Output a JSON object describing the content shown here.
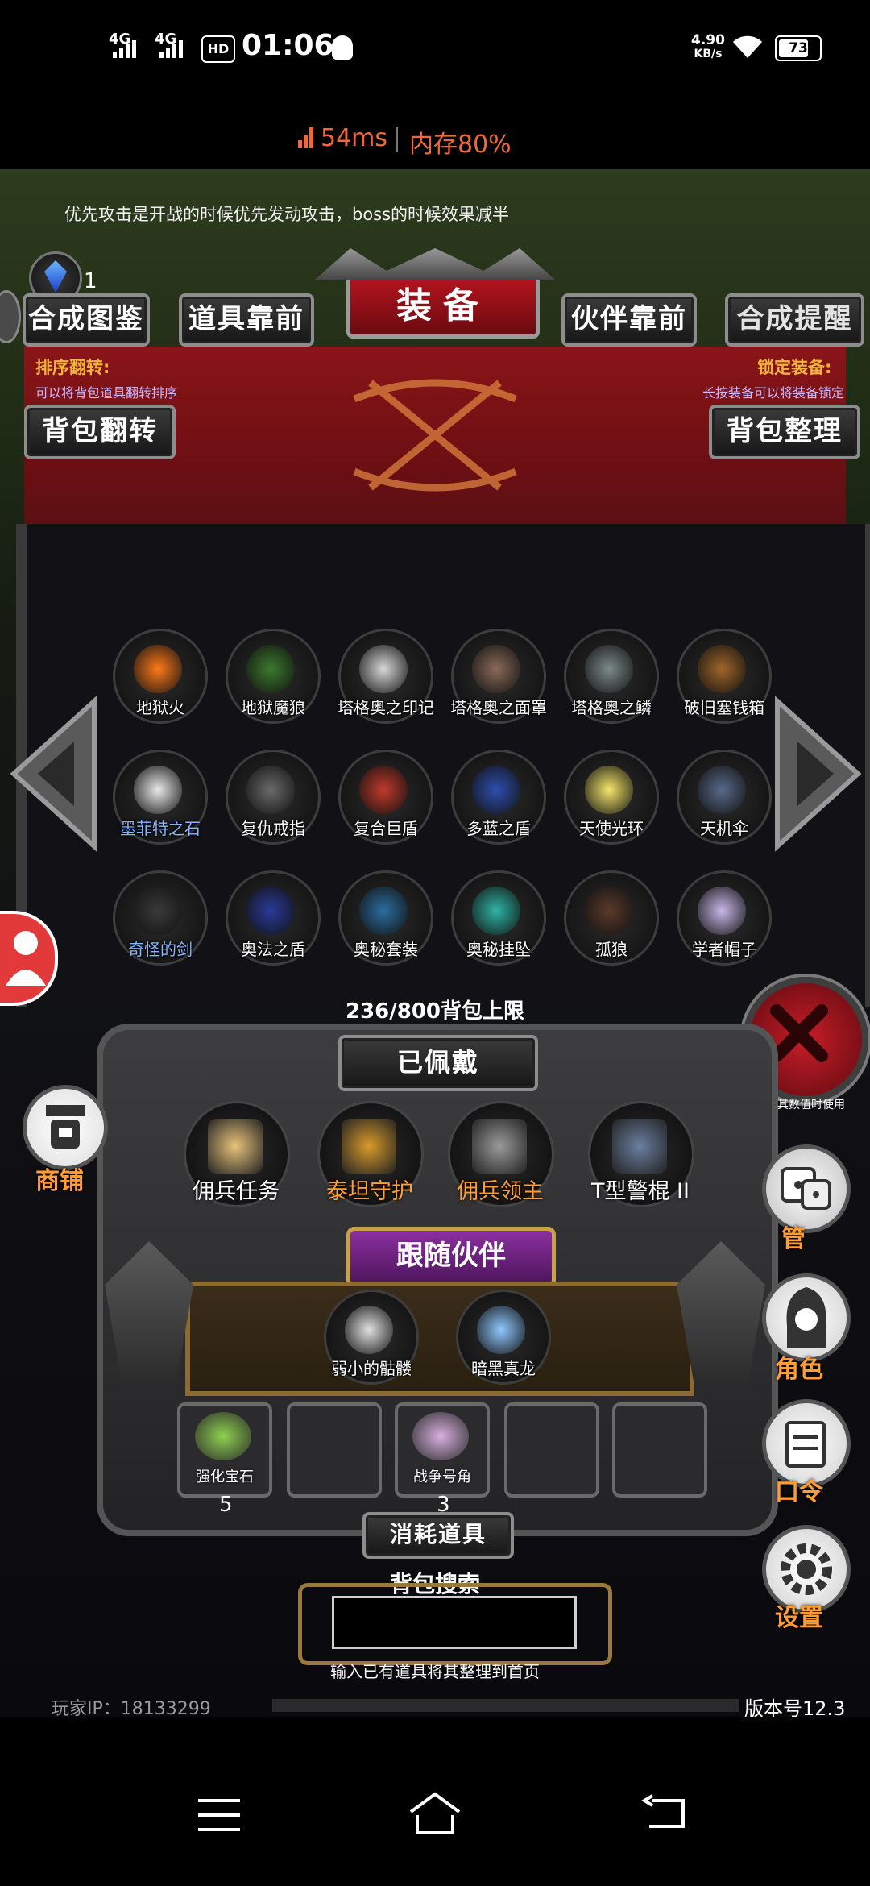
{
  "status_bar": {
    "signal1": "4G",
    "signal2": "4G",
    "hd": "HD",
    "time": "01:06",
    "speed_value": "4.90",
    "speed_unit": "KB/s",
    "battery": "73"
  },
  "perf": {
    "ping": "54ms",
    "memory": "内存80%"
  },
  "hint": "优先攻击是开战的时候优先发动攻击，boss的时候效果减半",
  "gem_count": "1",
  "title": "装备",
  "tabs": {
    "synth_guide": "合成图鉴",
    "items_first": "道具靠前",
    "partner_first": "伙伴靠前",
    "synth_remind": "合成提醒"
  },
  "left_note": {
    "title": "排序翻转:",
    "desc": "可以将背包道具翻转排序",
    "button": "背包翻转"
  },
  "right_note": {
    "title": "锁定装备:",
    "desc": "长按装备可以将装备锁定",
    "button": "背包整理"
  },
  "bag_items": [
    {
      "label": "地狱火",
      "color": "#ffffff"
    },
    {
      "label": "地狱魔狼",
      "color": "#ffffff"
    },
    {
      "label": "塔格奥之印记",
      "color": "#ffffff"
    },
    {
      "label": "塔格奥之面罩",
      "color": "#ffffff"
    },
    {
      "label": "塔格奥之鳞",
      "color": "#ffffff"
    },
    {
      "label": "破旧塞钱箱",
      "color": "#ffffff"
    },
    {
      "label": "墨菲特之石",
      "color": "#8ab4ff"
    },
    {
      "label": "复仇戒指",
      "color": "#ffffff"
    },
    {
      "label": "复合巨盾",
      "color": "#ffffff"
    },
    {
      "label": "多蓝之盾",
      "color": "#ffffff"
    },
    {
      "label": "天使光环",
      "color": "#ffffff"
    },
    {
      "label": "天机伞",
      "color": "#ffffff"
    },
    {
      "label": "奇怪的剑",
      "color": "#8ab4ff"
    },
    {
      "label": "奥法之盾",
      "color": "#ffffff"
    },
    {
      "label": "奥秘套装",
      "color": "#ffffff"
    },
    {
      "label": "奥秘挂坠",
      "color": "#ffffff"
    },
    {
      "label": "孤狼",
      "color": "#ffffff"
    },
    {
      "label": "学者帽子",
      "color": "#ffffff"
    }
  ],
  "capacity": "236/800背包上限",
  "equipped_title": "已佩戴",
  "equipped": [
    {
      "label": "佣兵任务",
      "color": "#ffffff"
    },
    {
      "label": "泰坦守护",
      "color": "#ff9c36"
    },
    {
      "label": "佣兵领主",
      "color": "#ff9c36"
    },
    {
      "label": "T型警棍 II",
      "color": "#ffffff"
    }
  ],
  "companion_title": "跟随伙伴",
  "companions": [
    {
      "label": "弱小的骷髅"
    },
    {
      "label": "暗黑真龙"
    }
  ],
  "consumables": [
    {
      "label": "强化宝石",
      "count": "5"
    },
    {
      "label": "",
      "count": ""
    },
    {
      "label": "战争号角",
      "count": "3"
    },
    {
      "label": "",
      "count": ""
    },
    {
      "label": "",
      "count": ""
    }
  ],
  "consumables_title": "消耗道具",
  "search": {
    "title": "背包搜索",
    "value": "",
    "hint": "输入已有道具将其整理到首页"
  },
  "side": {
    "shop": "商铺",
    "partial_top": "其数值时使用",
    "manage": "管",
    "role": "角色",
    "code": "口令",
    "settings": "设置"
  },
  "footer": {
    "player_ip": "玩家IP：18133299",
    "version": "版本号12.3"
  },
  "colors": {
    "accent_red": "#b4141e",
    "ping": "#f0683a",
    "orange_label": "#ff9c36"
  }
}
